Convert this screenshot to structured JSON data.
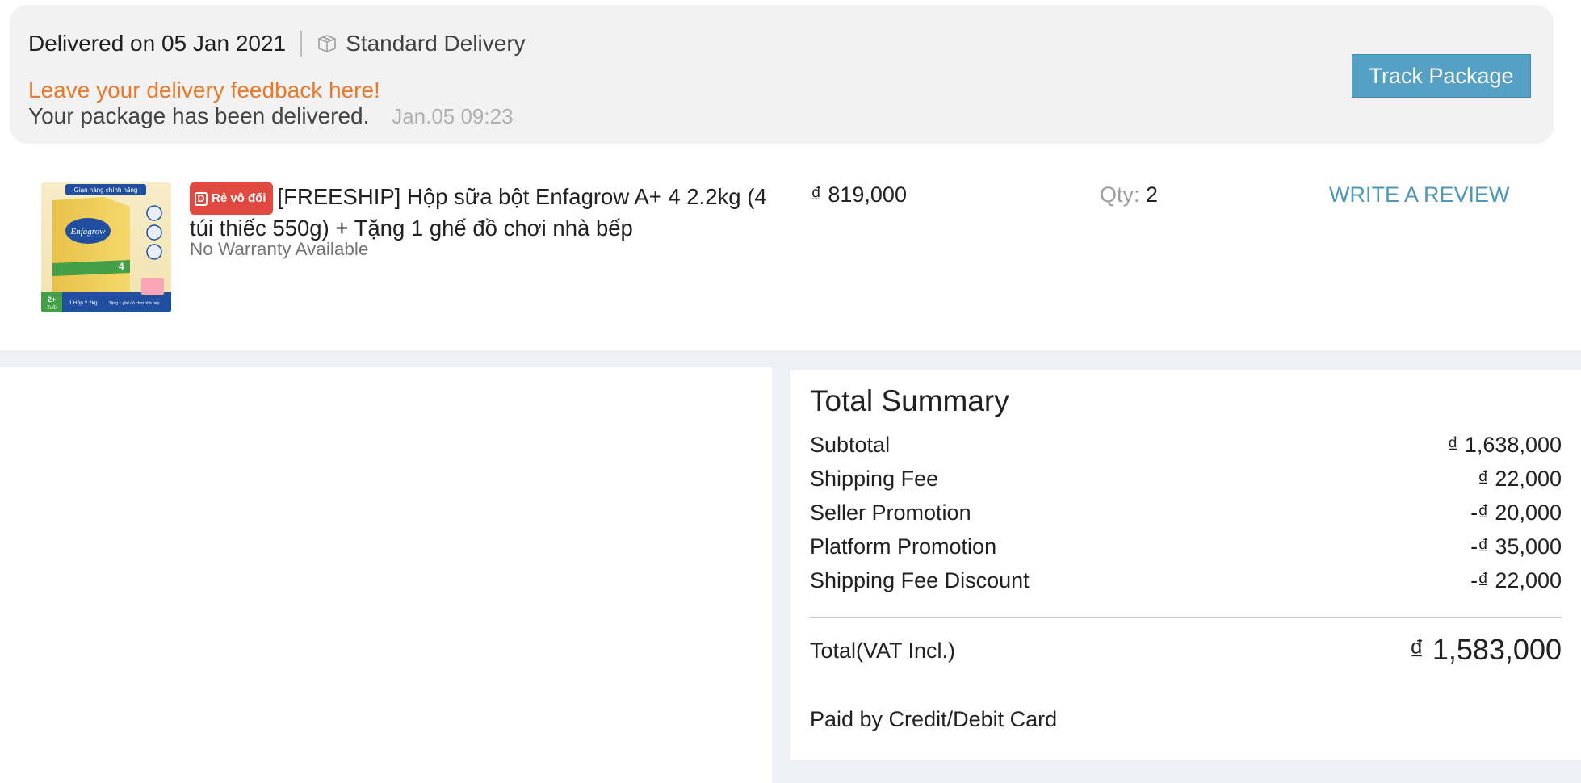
{
  "delivery": {
    "date_text": "Delivered on 05 Jan 2021",
    "type": "Standard Delivery",
    "type_icon": "truck-icon",
    "feedback_link": "Leave your delivery feedback here!",
    "status_message": "Your package has been delivered.",
    "status_time": "Jan.05 09:23",
    "track_button": "Track Package"
  },
  "product": {
    "badge": "Rẻ vô đối",
    "badge_icon": "D",
    "title": "[FREESHIP] Hộp sữa bột Enfagrow A+ 4 2.2kg (4 túi thiếc 550g) + Tặng 1 ghế đồ chơi nhà bếp",
    "warranty": "No Warranty Available",
    "price": "₫ 819,000",
    "qty_label": "Qty:",
    "qty_value": "2",
    "review_link": "WRITE A REVIEW",
    "image_texts": {
      "store_banner": "Gian hàng chính hãng",
      "brand": "Enfagrow",
      "stage": "4",
      "age": "2+",
      "age_unit": "Tuổi",
      "weight_label": "1 Hộp 2.2kg",
      "gift_label": "Tặng 1 ghế đồ chơi nhà bếp"
    }
  },
  "summary": {
    "title": "Total Summary",
    "rows": [
      {
        "label": "Subtotal",
        "value": "₫ 1,638,000"
      },
      {
        "label": "Shipping Fee",
        "value": "₫ 22,000"
      },
      {
        "label": "Seller Promotion",
        "value": "-₫ 20,000"
      },
      {
        "label": "Platform Promotion",
        "value": "-₫ 35,000"
      },
      {
        "label": "Shipping Fee Discount",
        "value": "-₫ 22,000"
      }
    ],
    "total_label": "Total(VAT Incl.)",
    "total_value": "₫ 1,583,000",
    "paid_by": "Paid by Credit/Debit Card"
  },
  "colors": {
    "accent_orange": "#e87a2e",
    "track_button_bg": "#55a0c4",
    "review_link": "#4d97b8",
    "badge_red": "#e1483f",
    "page_bg": "#eff0f5"
  }
}
